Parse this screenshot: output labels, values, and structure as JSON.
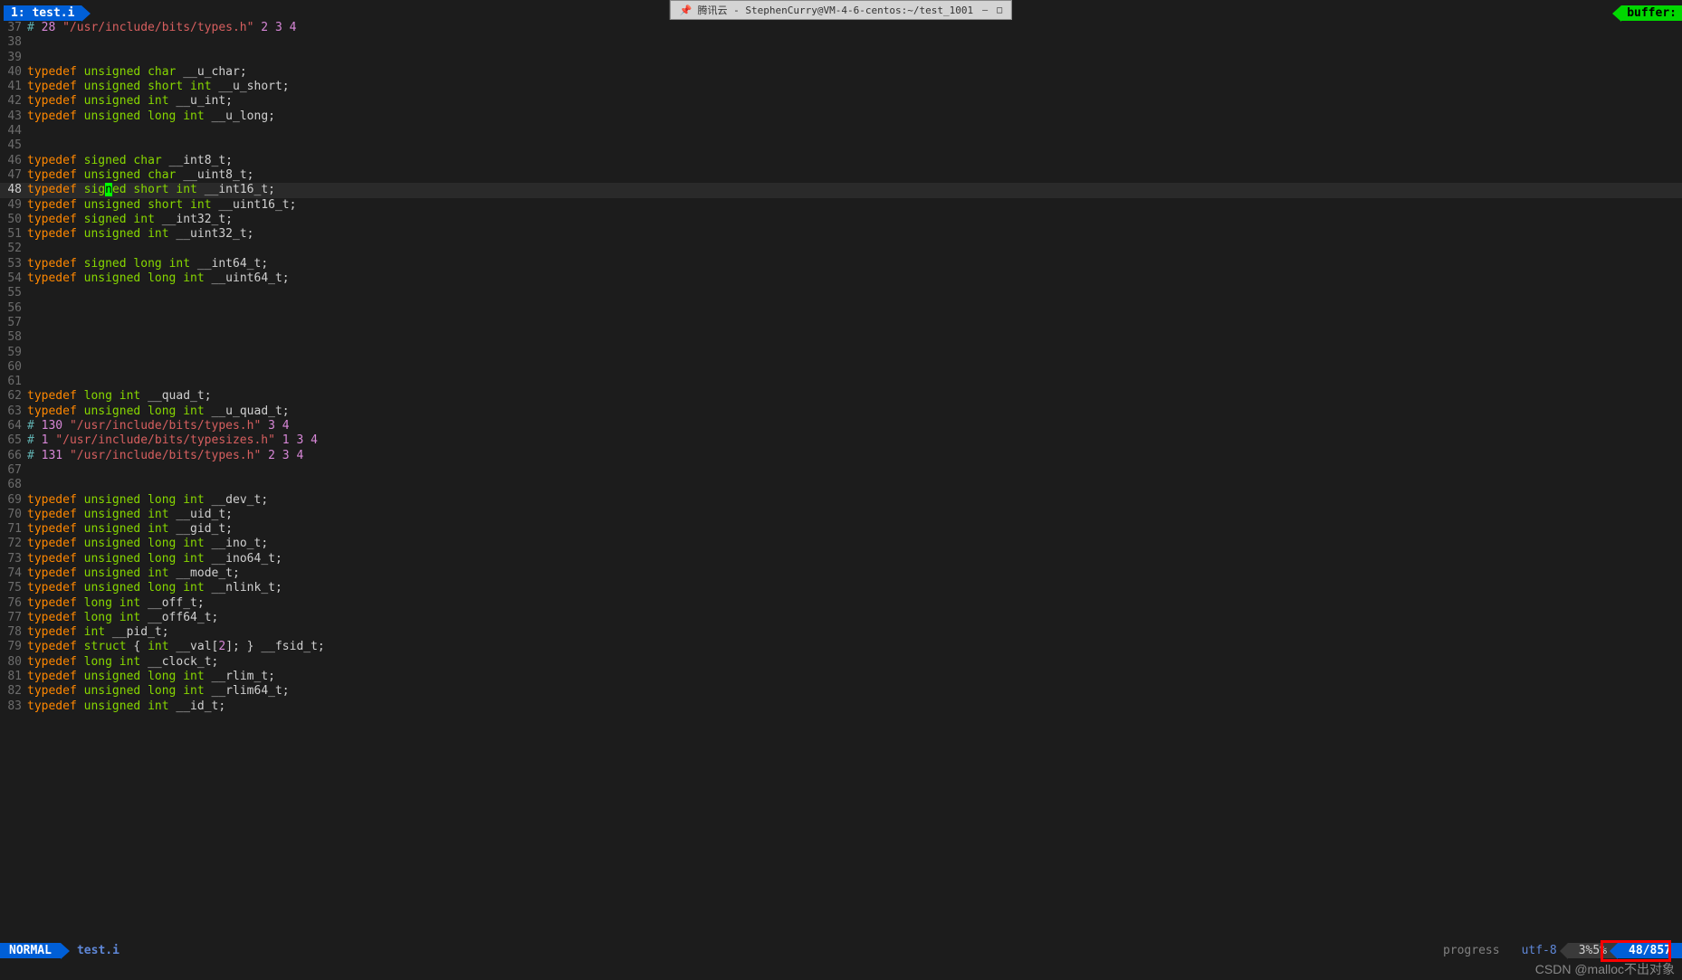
{
  "window": {
    "title": "腾讯云 - StephenCurry@VM-4-6-centos:~/test_1001"
  },
  "tab": {
    "label": "1: test.i"
  },
  "buffers_label": "buffer:",
  "statusbar": {
    "mode": "NORMAL",
    "filename": "test.i",
    "progress": "progress",
    "encoding": "utf-8",
    "percent": "3%5%",
    "position": "48/857"
  },
  "cursor": {
    "line": 48,
    "col_char": "n"
  },
  "watermark": "CSDN @malloc不出对象",
  "lines": [
    {
      "n": 37,
      "t": [
        {
          "c": "kw-teal",
          "v": "# "
        },
        {
          "c": "num",
          "v": "28"
        },
        {
          "c": "kw-teal",
          "v": " "
        },
        {
          "c": "str",
          "v": "\"/usr/include/bits/types.h\""
        },
        {
          "c": "kw-teal",
          "v": " "
        },
        {
          "c": "num",
          "v": "2"
        },
        {
          "c": "kw-teal",
          "v": " "
        },
        {
          "c": "num",
          "v": "3"
        },
        {
          "c": "kw-teal",
          "v": " "
        },
        {
          "c": "num",
          "v": "4"
        }
      ]
    },
    {
      "n": 38,
      "t": []
    },
    {
      "n": 39,
      "t": []
    },
    {
      "n": 40,
      "t": [
        {
          "c": "kw-orange",
          "v": "typedef"
        },
        {
          "c": "",
          "v": " "
        },
        {
          "c": "kw-green",
          "v": "unsigned"
        },
        {
          "c": "",
          "v": " "
        },
        {
          "c": "kw-green",
          "v": "char"
        },
        {
          "c": "",
          "v": " __u_char;"
        }
      ]
    },
    {
      "n": 41,
      "t": [
        {
          "c": "kw-orange",
          "v": "typedef"
        },
        {
          "c": "",
          "v": " "
        },
        {
          "c": "kw-green",
          "v": "unsigned"
        },
        {
          "c": "",
          "v": " "
        },
        {
          "c": "kw-green",
          "v": "short"
        },
        {
          "c": "",
          "v": " "
        },
        {
          "c": "kw-green",
          "v": "int"
        },
        {
          "c": "",
          "v": " __u_short;"
        }
      ]
    },
    {
      "n": 42,
      "t": [
        {
          "c": "kw-orange",
          "v": "typedef"
        },
        {
          "c": "",
          "v": " "
        },
        {
          "c": "kw-green",
          "v": "unsigned"
        },
        {
          "c": "",
          "v": " "
        },
        {
          "c": "kw-green",
          "v": "int"
        },
        {
          "c": "",
          "v": " __u_int;"
        }
      ]
    },
    {
      "n": 43,
      "t": [
        {
          "c": "kw-orange",
          "v": "typedef"
        },
        {
          "c": "",
          "v": " "
        },
        {
          "c": "kw-green",
          "v": "unsigned"
        },
        {
          "c": "",
          "v": " "
        },
        {
          "c": "kw-green",
          "v": "long"
        },
        {
          "c": "",
          "v": " "
        },
        {
          "c": "kw-green",
          "v": "int"
        },
        {
          "c": "",
          "v": " __u_long;"
        }
      ]
    },
    {
      "n": 44,
      "t": []
    },
    {
      "n": 45,
      "t": []
    },
    {
      "n": 46,
      "t": [
        {
          "c": "kw-orange",
          "v": "typedef"
        },
        {
          "c": "",
          "v": " "
        },
        {
          "c": "kw-green",
          "v": "signed"
        },
        {
          "c": "",
          "v": " "
        },
        {
          "c": "kw-green",
          "v": "char"
        },
        {
          "c": "",
          "v": " __int8_t;"
        }
      ]
    },
    {
      "n": 47,
      "t": [
        {
          "c": "kw-orange",
          "v": "typedef"
        },
        {
          "c": "",
          "v": " "
        },
        {
          "c": "kw-green",
          "v": "unsigned"
        },
        {
          "c": "",
          "v": " "
        },
        {
          "c": "kw-green",
          "v": "char"
        },
        {
          "c": "",
          "v": " __uint8_t;"
        }
      ]
    },
    {
      "n": 48,
      "current": true,
      "t": [
        {
          "c": "kw-orange",
          "v": "typedef"
        },
        {
          "c": "",
          "v": " "
        },
        {
          "c": "kw-green",
          "v": "sig"
        },
        {
          "c": "cursor",
          "v": "n"
        },
        {
          "c": "kw-green",
          "v": "ed"
        },
        {
          "c": "",
          "v": " "
        },
        {
          "c": "kw-green",
          "v": "short"
        },
        {
          "c": "",
          "v": " "
        },
        {
          "c": "kw-green",
          "v": "int"
        },
        {
          "c": "",
          "v": " __int16_t;"
        }
      ]
    },
    {
      "n": 49,
      "t": [
        {
          "c": "kw-orange",
          "v": "typedef"
        },
        {
          "c": "",
          "v": " "
        },
        {
          "c": "kw-green",
          "v": "unsigned"
        },
        {
          "c": "",
          "v": " "
        },
        {
          "c": "kw-green",
          "v": "short"
        },
        {
          "c": "",
          "v": " "
        },
        {
          "c": "kw-green",
          "v": "int"
        },
        {
          "c": "",
          "v": " __uint16_t;"
        }
      ]
    },
    {
      "n": 50,
      "t": [
        {
          "c": "kw-orange",
          "v": "typedef"
        },
        {
          "c": "",
          "v": " "
        },
        {
          "c": "kw-green",
          "v": "signed"
        },
        {
          "c": "",
          "v": " "
        },
        {
          "c": "kw-green",
          "v": "int"
        },
        {
          "c": "",
          "v": " __int32_t;"
        }
      ]
    },
    {
      "n": 51,
      "t": [
        {
          "c": "kw-orange",
          "v": "typedef"
        },
        {
          "c": "",
          "v": " "
        },
        {
          "c": "kw-green",
          "v": "unsigned"
        },
        {
          "c": "",
          "v": " "
        },
        {
          "c": "kw-green",
          "v": "int"
        },
        {
          "c": "",
          "v": " __uint32_t;"
        }
      ]
    },
    {
      "n": 52,
      "t": []
    },
    {
      "n": 53,
      "t": [
        {
          "c": "kw-orange",
          "v": "typedef"
        },
        {
          "c": "",
          "v": " "
        },
        {
          "c": "kw-green",
          "v": "signed"
        },
        {
          "c": "",
          "v": " "
        },
        {
          "c": "kw-green",
          "v": "long"
        },
        {
          "c": "",
          "v": " "
        },
        {
          "c": "kw-green",
          "v": "int"
        },
        {
          "c": "",
          "v": " __int64_t;"
        }
      ]
    },
    {
      "n": 54,
      "t": [
        {
          "c": "kw-orange",
          "v": "typedef"
        },
        {
          "c": "",
          "v": " "
        },
        {
          "c": "kw-green",
          "v": "unsigned"
        },
        {
          "c": "",
          "v": " "
        },
        {
          "c": "kw-green",
          "v": "long"
        },
        {
          "c": "",
          "v": " "
        },
        {
          "c": "kw-green",
          "v": "int"
        },
        {
          "c": "",
          "v": " __uint64_t;"
        }
      ]
    },
    {
      "n": 55,
      "t": []
    },
    {
      "n": 56,
      "t": []
    },
    {
      "n": 57,
      "t": []
    },
    {
      "n": 58,
      "t": []
    },
    {
      "n": 59,
      "t": []
    },
    {
      "n": 60,
      "t": []
    },
    {
      "n": 61,
      "t": []
    },
    {
      "n": 62,
      "t": [
        {
          "c": "kw-orange",
          "v": "typedef"
        },
        {
          "c": "",
          "v": " "
        },
        {
          "c": "kw-green",
          "v": "long"
        },
        {
          "c": "",
          "v": " "
        },
        {
          "c": "kw-green",
          "v": "int"
        },
        {
          "c": "",
          "v": " __quad_t;"
        }
      ]
    },
    {
      "n": 63,
      "t": [
        {
          "c": "kw-orange",
          "v": "typedef"
        },
        {
          "c": "",
          "v": " "
        },
        {
          "c": "kw-green",
          "v": "unsigned"
        },
        {
          "c": "",
          "v": " "
        },
        {
          "c": "kw-green",
          "v": "long"
        },
        {
          "c": "",
          "v": " "
        },
        {
          "c": "kw-green",
          "v": "int"
        },
        {
          "c": "",
          "v": " __u_quad_t;"
        }
      ]
    },
    {
      "n": 64,
      "t": [
        {
          "c": "kw-teal",
          "v": "# "
        },
        {
          "c": "num",
          "v": "130"
        },
        {
          "c": "kw-teal",
          "v": " "
        },
        {
          "c": "str",
          "v": "\"/usr/include/bits/types.h\""
        },
        {
          "c": "kw-teal",
          "v": " "
        },
        {
          "c": "num",
          "v": "3"
        },
        {
          "c": "kw-teal",
          "v": " "
        },
        {
          "c": "num",
          "v": "4"
        }
      ]
    },
    {
      "n": 65,
      "t": [
        {
          "c": "kw-teal",
          "v": "# "
        },
        {
          "c": "num",
          "v": "1"
        },
        {
          "c": "kw-teal",
          "v": " "
        },
        {
          "c": "str",
          "v": "\"/usr/include/bits/typesizes.h\""
        },
        {
          "c": "kw-teal",
          "v": " "
        },
        {
          "c": "num",
          "v": "1"
        },
        {
          "c": "kw-teal",
          "v": " "
        },
        {
          "c": "num",
          "v": "3"
        },
        {
          "c": "kw-teal",
          "v": " "
        },
        {
          "c": "num",
          "v": "4"
        }
      ]
    },
    {
      "n": 66,
      "t": [
        {
          "c": "kw-teal",
          "v": "# "
        },
        {
          "c": "num",
          "v": "131"
        },
        {
          "c": "kw-teal",
          "v": " "
        },
        {
          "c": "str",
          "v": "\"/usr/include/bits/types.h\""
        },
        {
          "c": "kw-teal",
          "v": " "
        },
        {
          "c": "num",
          "v": "2"
        },
        {
          "c": "kw-teal",
          "v": " "
        },
        {
          "c": "num",
          "v": "3"
        },
        {
          "c": "kw-teal",
          "v": " "
        },
        {
          "c": "num",
          "v": "4"
        }
      ]
    },
    {
      "n": 67,
      "t": []
    },
    {
      "n": 68,
      "t": []
    },
    {
      "n": 69,
      "t": [
        {
          "c": "kw-orange",
          "v": "typedef"
        },
        {
          "c": "",
          "v": " "
        },
        {
          "c": "kw-green",
          "v": "unsigned"
        },
        {
          "c": "",
          "v": " "
        },
        {
          "c": "kw-green",
          "v": "long"
        },
        {
          "c": "",
          "v": " "
        },
        {
          "c": "kw-green",
          "v": "int"
        },
        {
          "c": "",
          "v": " __dev_t;"
        }
      ]
    },
    {
      "n": 70,
      "t": [
        {
          "c": "kw-orange",
          "v": "typedef"
        },
        {
          "c": "",
          "v": " "
        },
        {
          "c": "kw-green",
          "v": "unsigned"
        },
        {
          "c": "",
          "v": " "
        },
        {
          "c": "kw-green",
          "v": "int"
        },
        {
          "c": "",
          "v": " __uid_t;"
        }
      ]
    },
    {
      "n": 71,
      "t": [
        {
          "c": "kw-orange",
          "v": "typedef"
        },
        {
          "c": "",
          "v": " "
        },
        {
          "c": "kw-green",
          "v": "unsigned"
        },
        {
          "c": "",
          "v": " "
        },
        {
          "c": "kw-green",
          "v": "int"
        },
        {
          "c": "",
          "v": " __gid_t;"
        }
      ]
    },
    {
      "n": 72,
      "t": [
        {
          "c": "kw-orange",
          "v": "typedef"
        },
        {
          "c": "",
          "v": " "
        },
        {
          "c": "kw-green",
          "v": "unsigned"
        },
        {
          "c": "",
          "v": " "
        },
        {
          "c": "kw-green",
          "v": "long"
        },
        {
          "c": "",
          "v": " "
        },
        {
          "c": "kw-green",
          "v": "int"
        },
        {
          "c": "",
          "v": " __ino_t;"
        }
      ]
    },
    {
      "n": 73,
      "t": [
        {
          "c": "kw-orange",
          "v": "typedef"
        },
        {
          "c": "",
          "v": " "
        },
        {
          "c": "kw-green",
          "v": "unsigned"
        },
        {
          "c": "",
          "v": " "
        },
        {
          "c": "kw-green",
          "v": "long"
        },
        {
          "c": "",
          "v": " "
        },
        {
          "c": "kw-green",
          "v": "int"
        },
        {
          "c": "",
          "v": " __ino64_t;"
        }
      ]
    },
    {
      "n": 74,
      "t": [
        {
          "c": "kw-orange",
          "v": "typedef"
        },
        {
          "c": "",
          "v": " "
        },
        {
          "c": "kw-green",
          "v": "unsigned"
        },
        {
          "c": "",
          "v": " "
        },
        {
          "c": "kw-green",
          "v": "int"
        },
        {
          "c": "",
          "v": " __mode_t;"
        }
      ]
    },
    {
      "n": 75,
      "t": [
        {
          "c": "kw-orange",
          "v": "typedef"
        },
        {
          "c": "",
          "v": " "
        },
        {
          "c": "kw-green",
          "v": "unsigned"
        },
        {
          "c": "",
          "v": " "
        },
        {
          "c": "kw-green",
          "v": "long"
        },
        {
          "c": "",
          "v": " "
        },
        {
          "c": "kw-green",
          "v": "int"
        },
        {
          "c": "",
          "v": " __nlink_t;"
        }
      ]
    },
    {
      "n": 76,
      "t": [
        {
          "c": "kw-orange",
          "v": "typedef"
        },
        {
          "c": "",
          "v": " "
        },
        {
          "c": "kw-green",
          "v": "long"
        },
        {
          "c": "",
          "v": " "
        },
        {
          "c": "kw-green",
          "v": "int"
        },
        {
          "c": "",
          "v": " __off_t;"
        }
      ]
    },
    {
      "n": 77,
      "t": [
        {
          "c": "kw-orange",
          "v": "typedef"
        },
        {
          "c": "",
          "v": " "
        },
        {
          "c": "kw-green",
          "v": "long"
        },
        {
          "c": "",
          "v": " "
        },
        {
          "c": "kw-green",
          "v": "int"
        },
        {
          "c": "",
          "v": " __off64_t;"
        }
      ]
    },
    {
      "n": 78,
      "t": [
        {
          "c": "kw-orange",
          "v": "typedef"
        },
        {
          "c": "",
          "v": " "
        },
        {
          "c": "kw-green",
          "v": "int"
        },
        {
          "c": "",
          "v": " __pid_t;"
        }
      ]
    },
    {
      "n": 79,
      "t": [
        {
          "c": "kw-orange",
          "v": "typedef"
        },
        {
          "c": "",
          "v": " "
        },
        {
          "c": "kw-green",
          "v": "struct"
        },
        {
          "c": "",
          "v": " { "
        },
        {
          "c": "kw-green",
          "v": "int"
        },
        {
          "c": "",
          "v": " __val["
        },
        {
          "c": "num",
          "v": "2"
        },
        {
          "c": "",
          "v": "]; } __fsid_t;"
        }
      ]
    },
    {
      "n": 80,
      "t": [
        {
          "c": "kw-orange",
          "v": "typedef"
        },
        {
          "c": "",
          "v": " "
        },
        {
          "c": "kw-green",
          "v": "long"
        },
        {
          "c": "",
          "v": " "
        },
        {
          "c": "kw-green",
          "v": "int"
        },
        {
          "c": "",
          "v": " __clock_t;"
        }
      ]
    },
    {
      "n": 81,
      "t": [
        {
          "c": "kw-orange",
          "v": "typedef"
        },
        {
          "c": "",
          "v": " "
        },
        {
          "c": "kw-green",
          "v": "unsigned"
        },
        {
          "c": "",
          "v": " "
        },
        {
          "c": "kw-green",
          "v": "long"
        },
        {
          "c": "",
          "v": " "
        },
        {
          "c": "kw-green",
          "v": "int"
        },
        {
          "c": "",
          "v": " __rlim_t;"
        }
      ]
    },
    {
      "n": 82,
      "t": [
        {
          "c": "kw-orange",
          "v": "typedef"
        },
        {
          "c": "",
          "v": " "
        },
        {
          "c": "kw-green",
          "v": "unsigned"
        },
        {
          "c": "",
          "v": " "
        },
        {
          "c": "kw-green",
          "v": "long"
        },
        {
          "c": "",
          "v": " "
        },
        {
          "c": "kw-green",
          "v": "int"
        },
        {
          "c": "",
          "v": " __rlim64_t;"
        }
      ]
    },
    {
      "n": 83,
      "t": [
        {
          "c": "kw-orange",
          "v": "typedef"
        },
        {
          "c": "",
          "v": " "
        },
        {
          "c": "kw-green",
          "v": "unsigned"
        },
        {
          "c": "",
          "v": " "
        },
        {
          "c": "kw-green",
          "v": "int"
        },
        {
          "c": "",
          "v": " __id_t;"
        }
      ]
    }
  ]
}
